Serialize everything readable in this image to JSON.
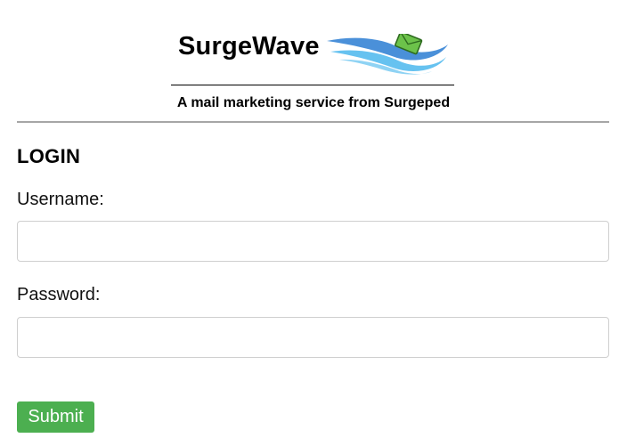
{
  "header": {
    "brand": "SurgeWave",
    "tagline": "A mail marketing service from Surgeped",
    "logo_icon": "wave-envelope-icon"
  },
  "login": {
    "title": "LOGIN",
    "username_label": "Username:",
    "username_value": "",
    "password_label": "Password:",
    "password_value": "",
    "submit_label": "Submit"
  },
  "colors": {
    "submit_bg": "#4caf50",
    "wave_blue": "#4a90d9",
    "wave_light": "#66c2f0",
    "envelope_green": "#6cc24a",
    "divider": "#a6a6a6"
  }
}
